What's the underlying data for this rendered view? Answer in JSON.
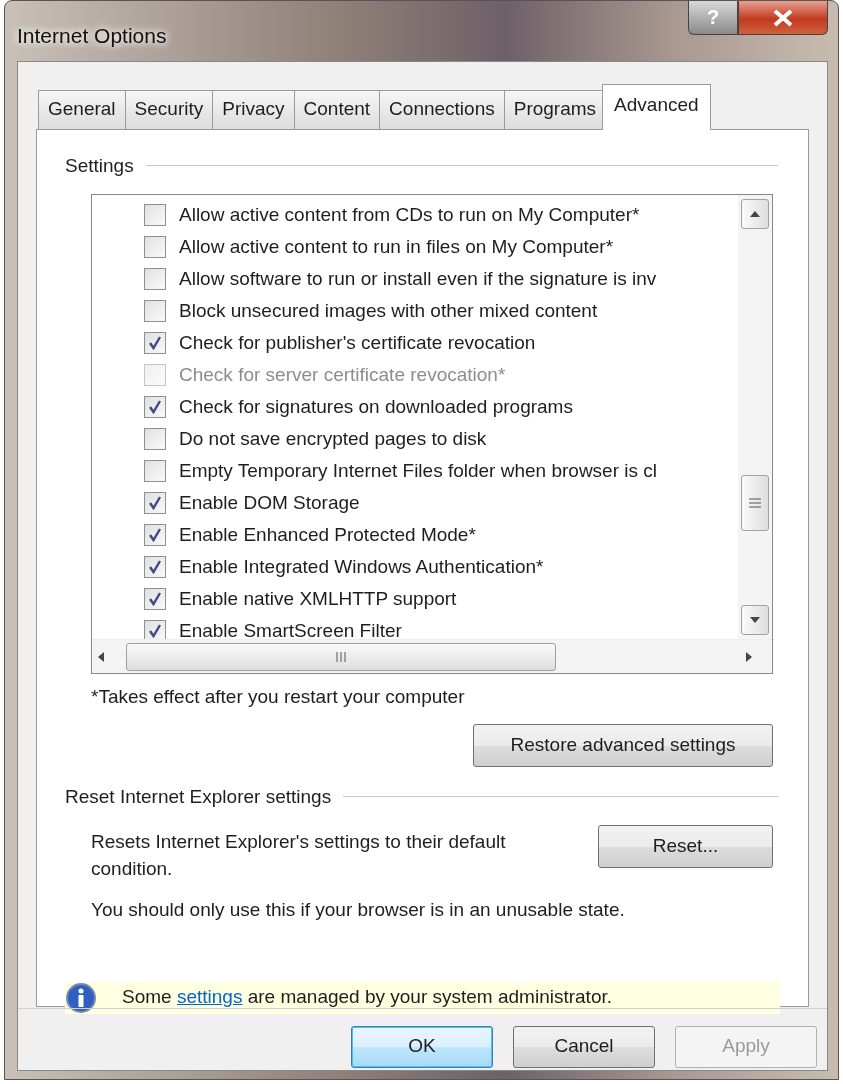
{
  "window": {
    "title": "Internet Options",
    "help_button": "?"
  },
  "tabs": [
    {
      "label": "General",
      "selected": false
    },
    {
      "label": "Security",
      "selected": false
    },
    {
      "label": "Privacy",
      "selected": false
    },
    {
      "label": "Content",
      "selected": false
    },
    {
      "label": "Connections",
      "selected": false
    },
    {
      "label": "Programs",
      "selected": false
    },
    {
      "label": "Advanced",
      "selected": true
    }
  ],
  "settings": {
    "title": "Settings",
    "items": [
      {
        "label": "Allow active content from CDs to run on My Computer*",
        "checked": false,
        "disabled": false
      },
      {
        "label": "Allow active content to run in files on My Computer*",
        "checked": false,
        "disabled": false
      },
      {
        "label": "Allow software to run or install even if the signature is inv",
        "checked": false,
        "disabled": false
      },
      {
        "label": "Block unsecured images with other mixed content",
        "checked": false,
        "disabled": false
      },
      {
        "label": "Check for publisher's certificate revocation",
        "checked": true,
        "disabled": false
      },
      {
        "label": "Check for server certificate revocation*",
        "checked": false,
        "disabled": true
      },
      {
        "label": "Check for signatures on downloaded programs",
        "checked": true,
        "disabled": false
      },
      {
        "label": "Do not save encrypted pages to disk",
        "checked": false,
        "disabled": false
      },
      {
        "label": "Empty Temporary Internet Files folder when browser is cl",
        "checked": false,
        "disabled": false
      },
      {
        "label": "Enable DOM Storage",
        "checked": true,
        "disabled": false
      },
      {
        "label": "Enable Enhanced Protected Mode*",
        "checked": true,
        "disabled": false
      },
      {
        "label": "Enable Integrated Windows Authentication*",
        "checked": true,
        "disabled": false
      },
      {
        "label": "Enable native XMLHTTP support",
        "checked": true,
        "disabled": false
      },
      {
        "label": "Enable SmartScreen Filter",
        "checked": true,
        "disabled": false
      }
    ],
    "footnote": "*Takes effect after you restart your computer",
    "restore_button": "Restore advanced settings"
  },
  "reset_group": {
    "title": "Reset Internet Explorer settings",
    "description": "Resets Internet Explorer's settings to their default condition.",
    "reset_button": "Reset...",
    "note": "You should only use this if your browser is in an unusable state."
  },
  "info_bar": {
    "text_before": "Some ",
    "link": "settings",
    "text_after": " are managed by your system administrator."
  },
  "buttons": [
    {
      "label": "OK",
      "kind": "default",
      "disabled": false
    },
    {
      "label": "Cancel",
      "kind": "normal",
      "disabled": false
    },
    {
      "label": "Apply",
      "kind": "normal",
      "disabled": true
    }
  ]
}
